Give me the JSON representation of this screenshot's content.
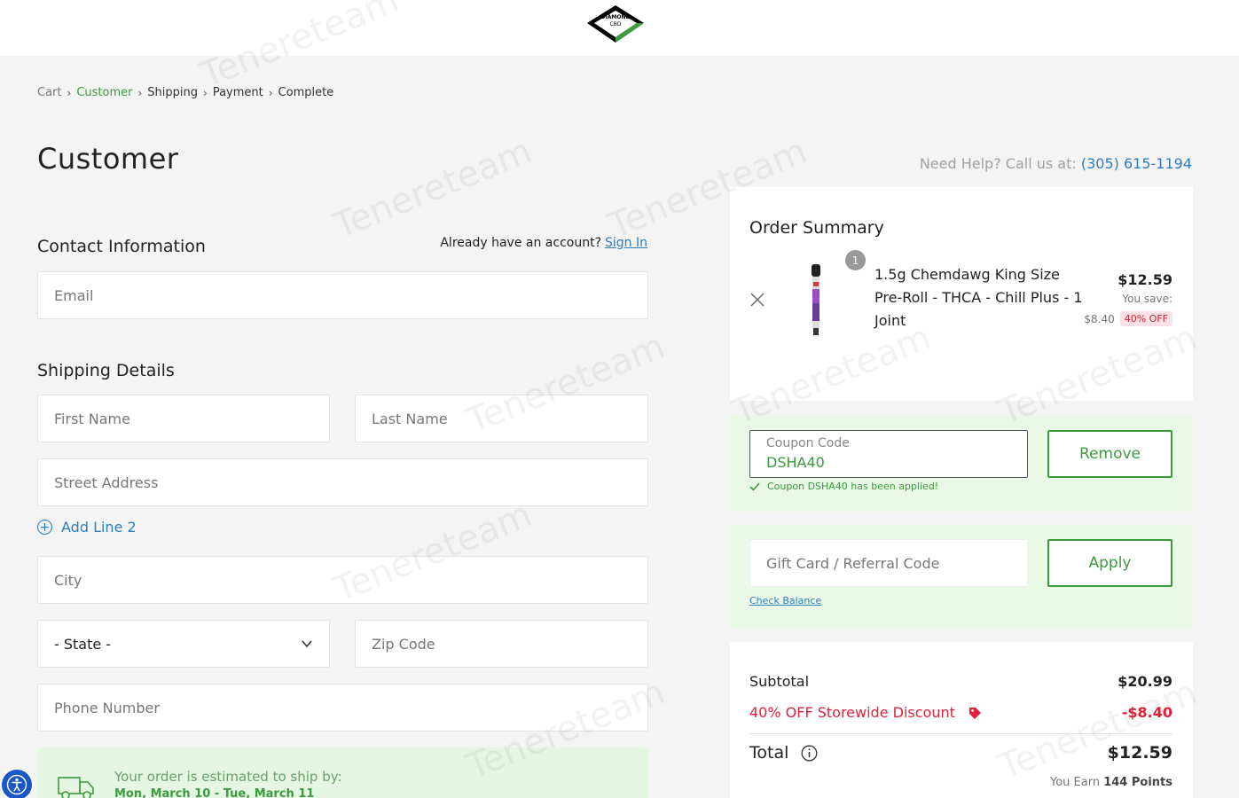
{
  "header": {
    "logo_text_top": "DIAMOND",
    "logo_text_bottom": "CBD"
  },
  "breadcrumb": [
    {
      "label": "Cart",
      "state": "muted"
    },
    {
      "label": "Customer",
      "state": "active"
    },
    {
      "label": "Shipping",
      "state": "normal"
    },
    {
      "label": "Payment",
      "state": "normal"
    },
    {
      "label": "Complete",
      "state": "normal"
    }
  ],
  "page_title": "Customer",
  "help": {
    "prefix": "Need Help? Call us at:",
    "phone": "(305) 615-1194"
  },
  "contact": {
    "title": "Contact Information",
    "account_prompt": "Already have an account?",
    "signin_label": "Sign In",
    "email_placeholder": "Email"
  },
  "shipping": {
    "title": "Shipping Details",
    "first_name_placeholder": "First Name",
    "last_name_placeholder": "Last Name",
    "street_placeholder": "Street Address",
    "add_line_label": "Add Line 2",
    "city_placeholder": "City",
    "state_selected": "- State -",
    "zip_placeholder": "Zip Code",
    "phone_placeholder": "Phone Number",
    "estimate_text": "Your order is estimated to ship by:",
    "estimate_dates": "Mon, March 10 - Tue, March 11"
  },
  "summary": {
    "title": "Order Summary",
    "item": {
      "quantity": "1",
      "name": "1.5g Chemdawg King Size Pre-Roll - THCA - Chill Plus - 1 Joint",
      "price": "$12.59",
      "you_save_label": "You save:",
      "save_amount": "$8.40",
      "discount_badge": "40% OFF"
    }
  },
  "coupon": {
    "label": "Coupon Code",
    "value": "DSHA40",
    "button": "Remove",
    "applied_message": "Coupon DSHA40 has been applied!"
  },
  "gift": {
    "placeholder": "Gift Card / Referral Code",
    "button": "Apply",
    "check_balance": "Check Balance"
  },
  "totals": {
    "subtotal_label": "Subtotal",
    "subtotal_value": "$20.99",
    "discount_label": "40% OFF Storewide Discount",
    "discount_value": "-$8.40",
    "total_label": "Total",
    "total_value": "$12.59",
    "earn_prefix": "You Earn",
    "earn_points": "144 Points"
  },
  "watermark_text": "Tenereteam",
  "colors": {
    "accent_green": "#3c9a3f",
    "link_blue": "#2e7cc4",
    "discount_red": "#e2223c",
    "panel_green": "#e9f9e6"
  }
}
